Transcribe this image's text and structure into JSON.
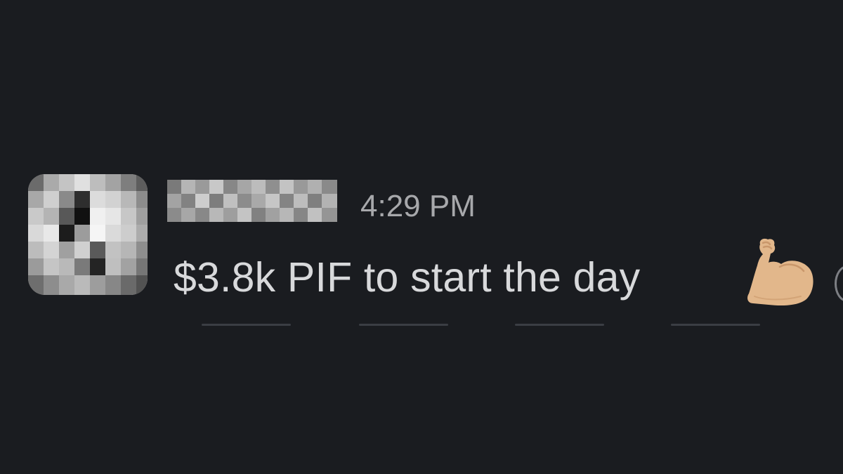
{
  "message": {
    "sender_name": "",
    "timestamp": "4:29 PM",
    "text": "$3.8k PIF to start the day",
    "emoji": "flexed-biceps"
  },
  "colors": {
    "background": "#1a1c20",
    "timestamp": "#a7a8ab",
    "message_text": "#d8d9db"
  }
}
